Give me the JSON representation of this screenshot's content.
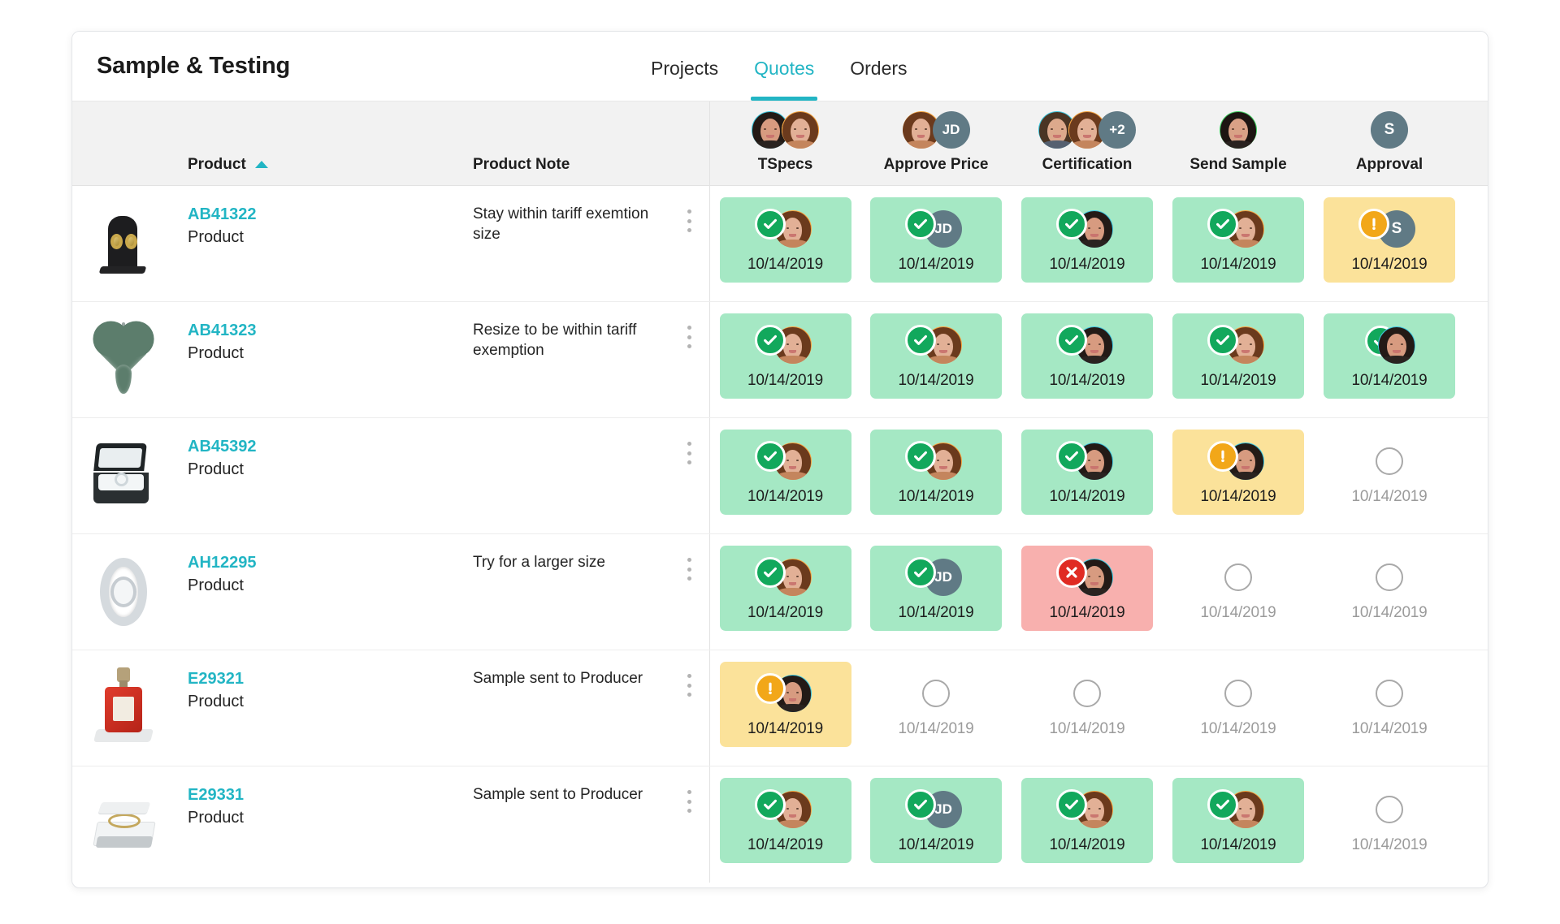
{
  "header": {
    "title": "Sample & Testing",
    "tabs": [
      {
        "label": "Projects",
        "active": false
      },
      {
        "label": "Quotes",
        "active": true
      },
      {
        "label": "Orders",
        "active": false
      }
    ]
  },
  "colors": {
    "accent": "#22b5c4",
    "done_bg": "#a5e8c4",
    "warn_bg": "#fbe29a",
    "error_bg": "#f8b0ae",
    "done_badge": "#12a85c",
    "warn_badge": "#f2a719",
    "error_badge": "#e02b23",
    "initials_avatar": "#607a85",
    "header_bg": "#f2f2f2"
  },
  "table": {
    "columns": {
      "product": {
        "label": "Product",
        "sorted": "asc",
        "sort_icon": "caret-up-icon"
      },
      "note": {
        "label": "Product Note"
      },
      "stages": [
        {
          "label": "TSpecs",
          "avatars": [
            {
              "type": "photo",
              "name": "avatar-woman-teal"
            },
            {
              "type": "photo",
              "name": "avatar-woman-orange"
            }
          ]
        },
        {
          "label": "Approve Price",
          "avatars": [
            {
              "type": "photo",
              "name": "avatar-woman-orange"
            },
            {
              "type": "initials",
              "initials": "JD",
              "name": "avatar-jd"
            }
          ]
        },
        {
          "label": "Certification",
          "avatars": [
            {
              "type": "photo",
              "name": "avatar-man-teal"
            },
            {
              "type": "photo",
              "name": "avatar-woman-orange"
            },
            {
              "type": "initials",
              "initials": "+2",
              "name": "avatar-overflow-plus-2"
            }
          ]
        },
        {
          "label": "Send Sample",
          "avatars": [
            {
              "type": "photo",
              "name": "avatar-woman-green"
            }
          ]
        },
        {
          "label": "Approval",
          "avatars": [
            {
              "type": "initials",
              "initials": "S",
              "name": "avatar-s"
            }
          ]
        }
      ]
    },
    "rows": [
      {
        "thumb": "earrings-on-stand",
        "id": "AB41322",
        "subtitle": "Product",
        "note": "Stay within tariff exemtion size",
        "menu_icon": "kebab-menu-icon",
        "cells": [
          {
            "state": "done",
            "date": "10/14/2019",
            "badge": "check-icon",
            "avatar": {
              "type": "photo",
              "name": "avatar-woman-orange"
            }
          },
          {
            "state": "done",
            "date": "10/14/2019",
            "badge": "check-icon",
            "avatar": {
              "type": "initials",
              "initials": "JD",
              "name": "avatar-jd"
            }
          },
          {
            "state": "done",
            "date": "10/14/2019",
            "badge": "check-icon",
            "avatar": {
              "type": "photo",
              "name": "avatar-woman-teal"
            }
          },
          {
            "state": "done",
            "date": "10/14/2019",
            "badge": "check-icon",
            "avatar": {
              "type": "photo",
              "name": "avatar-woman-orange"
            }
          },
          {
            "state": "warn",
            "date": "10/14/2019",
            "badge": "exclamation-icon",
            "avatar": {
              "type": "initials",
              "initials": "S",
              "name": "avatar-s"
            }
          }
        ]
      },
      {
        "thumb": "heart-pendant",
        "id": "AB41323",
        "subtitle": "Product",
        "note": "Resize to be within tariff exemption",
        "menu_icon": "kebab-menu-icon",
        "cells": [
          {
            "state": "done",
            "date": "10/14/2019",
            "badge": "check-icon",
            "avatar": {
              "type": "photo",
              "name": "avatar-woman-orange"
            }
          },
          {
            "state": "done",
            "date": "10/14/2019",
            "badge": "check-icon",
            "avatar": {
              "type": "photo",
              "name": "avatar-woman-orange"
            }
          },
          {
            "state": "done",
            "date": "10/14/2019",
            "badge": "check-icon",
            "avatar": {
              "type": "photo",
              "name": "avatar-woman-teal"
            }
          },
          {
            "state": "done",
            "date": "10/14/2019",
            "badge": "check-icon",
            "avatar": {
              "type": "photo",
              "name": "avatar-woman-orange"
            }
          },
          {
            "state": "done",
            "date": "10/14/2019",
            "badge": "check-icon",
            "badge_behind": true,
            "avatar": {
              "type": "photo",
              "name": "avatar-woman-teal"
            }
          }
        ]
      },
      {
        "thumb": "ring-box",
        "id": "AB45392",
        "subtitle": "Product",
        "note": "",
        "menu_icon": "kebab-menu-icon",
        "cells": [
          {
            "state": "done",
            "date": "10/14/2019",
            "badge": "check-icon",
            "avatar": {
              "type": "photo",
              "name": "avatar-woman-orange"
            }
          },
          {
            "state": "done",
            "date": "10/14/2019",
            "badge": "check-icon",
            "avatar": {
              "type": "photo",
              "name": "avatar-woman-orange"
            }
          },
          {
            "state": "done",
            "date": "10/14/2019",
            "badge": "check-icon",
            "avatar": {
              "type": "photo",
              "name": "avatar-woman-teal"
            }
          },
          {
            "state": "warn",
            "date": "10/14/2019",
            "badge": "exclamation-icon",
            "avatar": {
              "type": "photo",
              "name": "avatar-woman-teal"
            }
          },
          {
            "state": "empty",
            "date": "10/14/2019",
            "badge": "empty-circle-icon"
          }
        ]
      },
      {
        "thumb": "watch",
        "id": "AH12295",
        "subtitle": "Product",
        "note": "Try for a larger size",
        "menu_icon": "kebab-menu-icon",
        "cells": [
          {
            "state": "done",
            "date": "10/14/2019",
            "badge": "check-icon",
            "avatar": {
              "type": "photo",
              "name": "avatar-woman-orange"
            }
          },
          {
            "state": "done",
            "date": "10/14/2019",
            "badge": "check-icon",
            "avatar": {
              "type": "initials",
              "initials": "JD",
              "name": "avatar-jd"
            }
          },
          {
            "state": "error",
            "date": "10/14/2019",
            "badge": "close-icon",
            "avatar": {
              "type": "photo",
              "name": "avatar-woman-teal"
            }
          },
          {
            "state": "empty",
            "date": "10/14/2019",
            "badge": "empty-circle-icon"
          },
          {
            "state": "empty",
            "date": "10/14/2019",
            "badge": "empty-circle-icon"
          }
        ]
      },
      {
        "thumb": "perfume-bottle",
        "id": "E29321",
        "subtitle": "Product",
        "note": "Sample sent to Producer",
        "menu_icon": "kebab-menu-icon",
        "cells": [
          {
            "state": "warn",
            "date": "10/14/2019",
            "badge": "exclamation-icon",
            "avatar": {
              "type": "photo",
              "name": "avatar-woman-teal"
            }
          },
          {
            "state": "empty",
            "date": "10/14/2019",
            "badge": "empty-circle-icon"
          },
          {
            "state": "empty",
            "date": "10/14/2019",
            "badge": "empty-circle-icon"
          },
          {
            "state": "empty",
            "date": "10/14/2019",
            "badge": "empty-circle-icon"
          },
          {
            "state": "empty",
            "date": "10/14/2019",
            "badge": "empty-circle-icon"
          }
        ]
      },
      {
        "thumb": "bangle-in-box",
        "id": "E29331",
        "subtitle": "Product",
        "note": "Sample sent to Producer",
        "menu_icon": "kebab-menu-icon",
        "cells": [
          {
            "state": "done",
            "date": "10/14/2019",
            "badge": "check-icon",
            "avatar": {
              "type": "photo",
              "name": "avatar-woman-orange"
            }
          },
          {
            "state": "done",
            "date": "10/14/2019",
            "badge": "check-icon",
            "avatar": {
              "type": "initials",
              "initials": "JD",
              "name": "avatar-jd"
            }
          },
          {
            "state": "done",
            "date": "10/14/2019",
            "badge": "check-icon",
            "avatar": {
              "type": "photo",
              "name": "avatar-woman-orange"
            }
          },
          {
            "state": "done",
            "date": "10/14/2019",
            "badge": "check-icon",
            "avatar": {
              "type": "photo",
              "name": "avatar-woman-orange"
            }
          },
          {
            "state": "empty",
            "date": "10/14/2019",
            "badge": "empty-circle-icon"
          }
        ]
      }
    ]
  }
}
